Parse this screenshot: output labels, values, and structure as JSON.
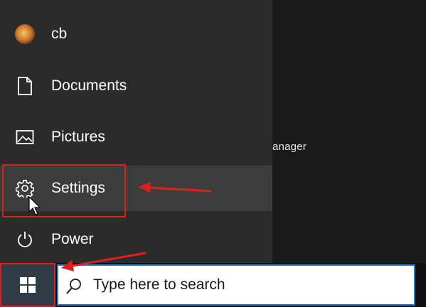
{
  "start_menu": {
    "items": [
      {
        "label": "cb",
        "icon": "user-avatar"
      },
      {
        "label": "Documents",
        "icon": "document-icon"
      },
      {
        "label": "Pictures",
        "icon": "pictures-icon"
      },
      {
        "label": "Settings",
        "icon": "gear-icon"
      },
      {
        "label": "Power",
        "icon": "power-icon"
      }
    ]
  },
  "background": {
    "partial_text": "anager"
  },
  "taskbar": {
    "start_icon": "windows-logo-icon",
    "search_placeholder": "Type here to search",
    "search_icon": "search-icon"
  },
  "colors": {
    "annotation_red": "#e01e1e",
    "search_border": "#1f7ad6",
    "menu_bg": "#2b2b2b",
    "hover_bg": "#3c3c3c"
  }
}
